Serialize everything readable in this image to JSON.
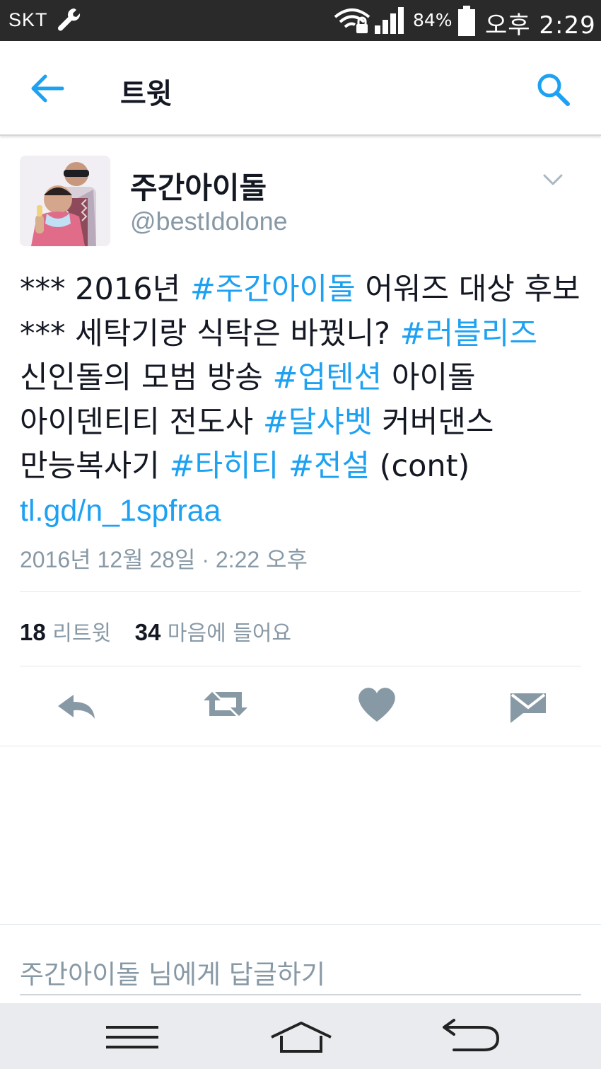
{
  "status_bar": {
    "carrier": "SKT",
    "battery_percent": "84%",
    "time": "오후 2:29",
    "icons": [
      "wrench-icon",
      "wifi-lock-icon",
      "signal-icon",
      "battery-icon"
    ]
  },
  "header": {
    "title": "트윗",
    "back_icon": "arrow-left-icon",
    "search_icon": "search-icon"
  },
  "tweet": {
    "display_name": "주간아이돌",
    "handle": "@bestIdolone",
    "text": {
      "t1": "*** 2016년 ",
      "h1": "#주간아이돌",
      "t2": " 어워즈 대상 후보 *** 세탁기랑 식탁은 바꿨니? ",
      "h2": "#러블리즈",
      "t3": " 신인돌의 모범 방송 ",
      "h3": "#업텐션",
      "t4": " 아이돌 아이덴티티 전도사 ",
      "h4": "#달샤벳",
      "t5": " 커버댄스 만능복사기 ",
      "h5": "#타히티",
      "t6": " ",
      "h6": "#전설",
      "t7": " (cont) ",
      "link": "tl.gd/n_1spfraa"
    },
    "timestamp": "2016년 12월 28일 · 2:22 오후",
    "stats": {
      "retweets_count": "18",
      "retweets_label": "리트윗",
      "likes_count": "34",
      "likes_label": "마음에 들어요"
    },
    "accent_color": "#1da1f2"
  },
  "actions": [
    "reply-icon",
    "retweet-icon",
    "heart-icon",
    "message-icon"
  ],
  "reply_box": {
    "placeholder": "주간아이돌 님에게 답글하기"
  },
  "nav_bar": [
    "menu-icon",
    "home-icon",
    "back-icon"
  ]
}
